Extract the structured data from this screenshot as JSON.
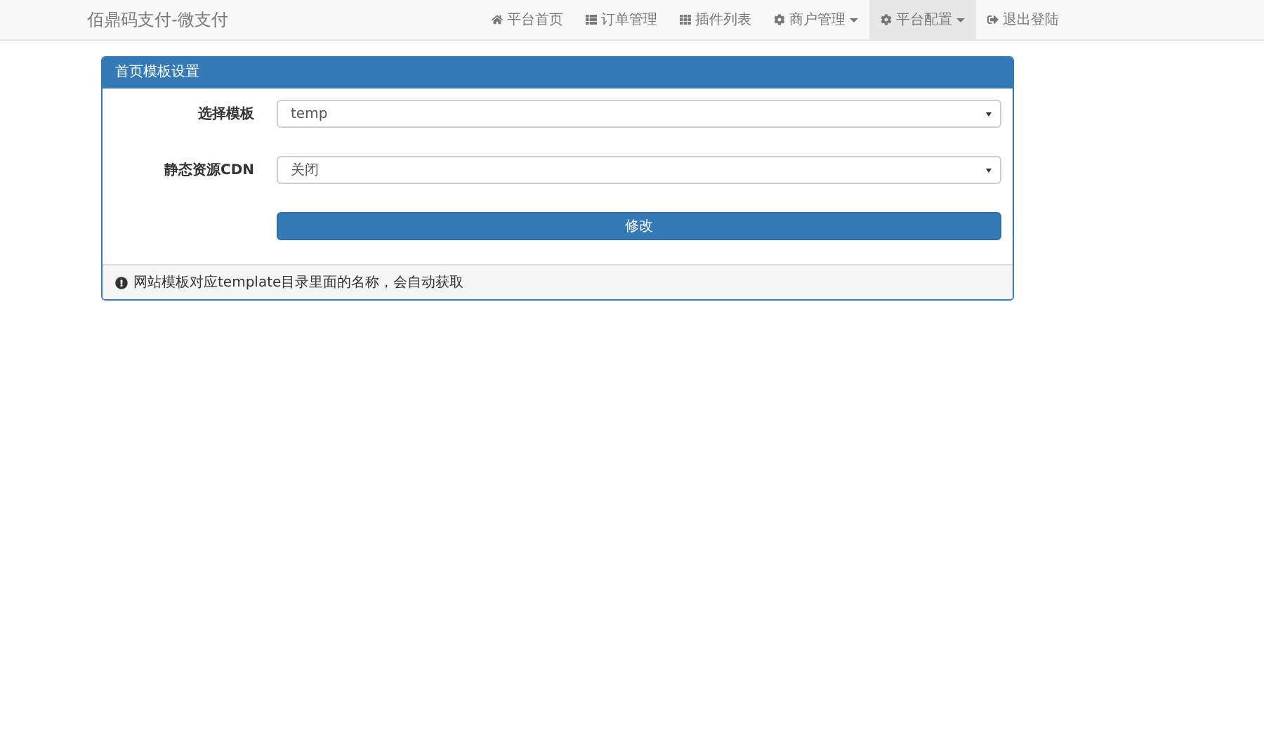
{
  "navbar": {
    "brand": "佰鼎码支付-微支付",
    "items": [
      {
        "label": "平台首页",
        "kind": "home",
        "dropdown": false,
        "selected": false
      },
      {
        "label": "订单管理",
        "kind": "list",
        "dropdown": false,
        "selected": false
      },
      {
        "label": "插件列表",
        "kind": "grid",
        "dropdown": false,
        "selected": false
      },
      {
        "label": "商户管理",
        "kind": "gear",
        "dropdown": true,
        "selected": false
      },
      {
        "label": "平台配置",
        "kind": "gear",
        "dropdown": true,
        "selected": true
      },
      {
        "label": "退出登陆",
        "kind": "logout",
        "dropdown": false,
        "selected": false
      }
    ]
  },
  "panel": {
    "title": "首页模板设置",
    "fields": [
      {
        "label": "选择模板",
        "value": "temp"
      },
      {
        "label": "静态资源CDN",
        "value": "关闭"
      }
    ],
    "submit": "修改",
    "footer": "网站模板对应template目录里面的名称，会自动获取"
  }
}
